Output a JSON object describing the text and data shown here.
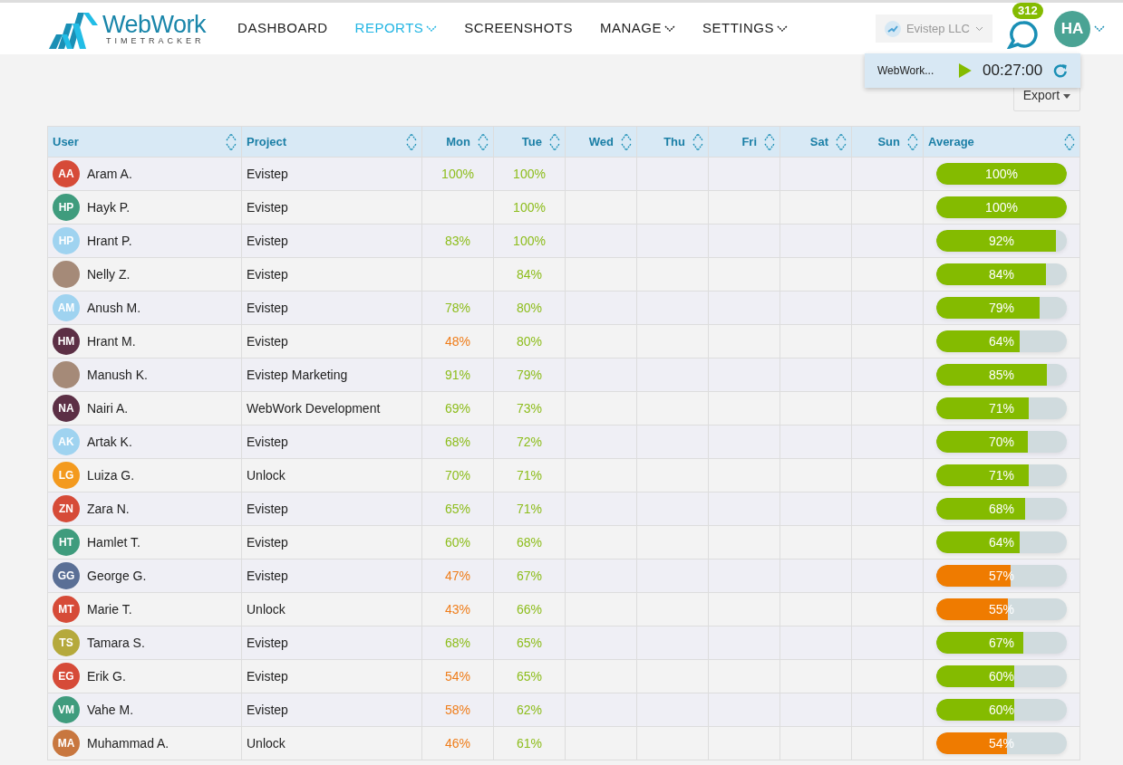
{
  "brand": {
    "name": "WebWork",
    "tagline": "TIMETRACKER"
  },
  "nav": [
    {
      "label": "DASHBOARD",
      "selected": false,
      "dropdown": false
    },
    {
      "label": "REPORTS",
      "selected": true,
      "dropdown": true
    },
    {
      "label": "SCREENSHOTS",
      "selected": false,
      "dropdown": false
    },
    {
      "label": "MANAGE",
      "selected": false,
      "dropdown": true
    },
    {
      "label": "SETTINGS",
      "selected": false,
      "dropdown": true
    }
  ],
  "company": {
    "name": "Evistep LLC"
  },
  "notifications": {
    "count": "312"
  },
  "user": {
    "initials": "HA"
  },
  "timer": {
    "project": "WebWork...",
    "time": "00:27:00"
  },
  "export": {
    "label": "Export"
  },
  "table": {
    "columns": [
      "User",
      "Project",
      "Mon",
      "Tue",
      "Wed",
      "Thu",
      "Fri",
      "Sat",
      "Sun",
      "Average"
    ],
    "rows": [
      {
        "user": "Aram  A.",
        "avatar": {
          "kind": "initials",
          "initials": "AA",
          "color": "#d64b38"
        },
        "project": "Evistep",
        "days": {
          "mon": {
            "text": "100%",
            "color": "#8dbd1c"
          },
          "tue": {
            "text": "100%",
            "color": "#8dbd1c"
          }
        },
        "average": {
          "text": "100%",
          "level": 1,
          "color": "#84bb00"
        }
      },
      {
        "user": "Hayk  P.",
        "avatar": {
          "kind": "initials",
          "initials": "HP",
          "color": "#3f9c7d"
        },
        "project": "Evistep",
        "days": {
          "tue": {
            "text": "100%",
            "color": "#8dbd1c"
          }
        },
        "average": {
          "text": "100%",
          "level": 1,
          "color": "#84bb00"
        }
      },
      {
        "user": "Hrant  P.",
        "avatar": {
          "kind": "initials",
          "initials": "HP",
          "color": "#9fd3f0"
        },
        "project": "Evistep",
        "days": {
          "mon": {
            "text": "83%",
            "color": "#8dbd1c"
          },
          "tue": {
            "text": "100%",
            "color": "#8dbd1c"
          }
        },
        "average": {
          "text": "92%",
          "level": 0.92,
          "color": "#84bb00"
        }
      },
      {
        "user": "Nelly  Z.",
        "avatar": {
          "kind": "photo"
        },
        "project": "Evistep",
        "days": {
          "tue": {
            "text": "84%",
            "color": "#8dbd1c"
          }
        },
        "average": {
          "text": "84%",
          "level": 0.84,
          "color": "#84bb00"
        }
      },
      {
        "user": "Anush  M.",
        "avatar": {
          "kind": "initials",
          "initials": "AM",
          "color": "#9fd3f0"
        },
        "project": "Evistep",
        "days": {
          "mon": {
            "text": "78%",
            "color": "#8dbd1c"
          },
          "tue": {
            "text": "80%",
            "color": "#8dbd1c"
          }
        },
        "average": {
          "text": "79%",
          "level": 0.79,
          "color": "#84bb00"
        }
      },
      {
        "user": "Hrant  M.",
        "avatar": {
          "kind": "initials",
          "initials": "HM",
          "color": "#5c2f45"
        },
        "project": "Evistep",
        "days": {
          "mon": {
            "text": "48%",
            "color": "#ef7d1a"
          },
          "tue": {
            "text": "80%",
            "color": "#8dbd1c"
          }
        },
        "average": {
          "text": "64%",
          "level": 0.64,
          "color": "#84bb00"
        }
      },
      {
        "user": "Manush  K.",
        "avatar": {
          "kind": "photo"
        },
        "project": "Evistep  Marketing",
        "days": {
          "mon": {
            "text": "91%",
            "color": "#8dbd1c"
          },
          "tue": {
            "text": "79%",
            "color": "#8dbd1c"
          }
        },
        "average": {
          "text": "85%",
          "level": 0.85,
          "color": "#84bb00"
        }
      },
      {
        "user": "Nairi  A.",
        "avatar": {
          "kind": "initials",
          "initials": "NA",
          "color": "#5c2f45"
        },
        "project": "WebWork  Development",
        "days": {
          "mon": {
            "text": "69%",
            "color": "#8dbd1c"
          },
          "tue": {
            "text": "73%",
            "color": "#8dbd1c"
          }
        },
        "average": {
          "text": "71%",
          "level": 0.71,
          "color": "#84bb00"
        }
      },
      {
        "user": "Artak  K.",
        "avatar": {
          "kind": "initials",
          "initials": "AK",
          "color": "#9fd3f0"
        },
        "project": "Evistep",
        "days": {
          "mon": {
            "text": "68%",
            "color": "#8dbd1c"
          },
          "tue": {
            "text": "72%",
            "color": "#8dbd1c"
          }
        },
        "average": {
          "text": "70%",
          "level": 0.7,
          "color": "#84bb00"
        }
      },
      {
        "user": "Luiza  G.",
        "avatar": {
          "kind": "initials",
          "initials": "LG",
          "color": "#f39a1e"
        },
        "project": "Unlock",
        "days": {
          "mon": {
            "text": "70%",
            "color": "#8dbd1c"
          },
          "tue": {
            "text": "71%",
            "color": "#8dbd1c"
          }
        },
        "average": {
          "text": "71%",
          "level": 0.71,
          "color": "#84bb00"
        }
      },
      {
        "user": "Zara  N.",
        "avatar": {
          "kind": "initials",
          "initials": "ZN",
          "color": "#d64b38"
        },
        "project": "Evistep",
        "days": {
          "mon": {
            "text": "65%",
            "color": "#8dbd1c"
          },
          "tue": {
            "text": "71%",
            "color": "#8dbd1c"
          }
        },
        "average": {
          "text": "68%",
          "level": 0.68,
          "color": "#84bb00"
        }
      },
      {
        "user": "Hamlet  T.",
        "avatar": {
          "kind": "initials",
          "initials": "HT",
          "color": "#3f9c7d"
        },
        "project": "Evistep",
        "days": {
          "mon": {
            "text": "60%",
            "color": "#8dbd1c"
          },
          "tue": {
            "text": "68%",
            "color": "#8dbd1c"
          }
        },
        "average": {
          "text": "64%",
          "level": 0.64,
          "color": "#84bb00"
        }
      },
      {
        "user": "George  G.",
        "avatar": {
          "kind": "initials",
          "initials": "GG",
          "color": "#5a6f96"
        },
        "project": "Evistep",
        "days": {
          "mon": {
            "text": "47%",
            "color": "#ef7d1a"
          },
          "tue": {
            "text": "67%",
            "color": "#8dbd1c"
          }
        },
        "average": {
          "text": "57%",
          "level": 0.57,
          "color": "#ef7b00"
        }
      },
      {
        "user": "Marie  T.",
        "avatar": {
          "kind": "initials",
          "initials": "MT",
          "color": "#d64b38"
        },
        "project": "Unlock",
        "days": {
          "mon": {
            "text": "43%",
            "color": "#ef7d1a"
          },
          "tue": {
            "text": "66%",
            "color": "#8dbd1c"
          }
        },
        "average": {
          "text": "55%",
          "level": 0.55,
          "color": "#ef7b00"
        }
      },
      {
        "user": "Tamara  S.",
        "avatar": {
          "kind": "initials",
          "initials": "TS",
          "color": "#b5a93c"
        },
        "project": "Evistep",
        "days": {
          "mon": {
            "text": "68%",
            "color": "#8dbd1c"
          },
          "tue": {
            "text": "65%",
            "color": "#8dbd1c"
          }
        },
        "average": {
          "text": "67%",
          "level": 0.67,
          "color": "#84bb00"
        }
      },
      {
        "user": "Erik  G.",
        "avatar": {
          "kind": "initials",
          "initials": "EG",
          "color": "#d64b38"
        },
        "project": "Evistep",
        "days": {
          "mon": {
            "text": "54%",
            "color": "#ef7d1a"
          },
          "tue": {
            "text": "65%",
            "color": "#8dbd1c"
          }
        },
        "average": {
          "text": "60%",
          "level": 0.6,
          "color": "#84bb00"
        }
      },
      {
        "user": "Vahe  M.",
        "avatar": {
          "kind": "initials",
          "initials": "VM",
          "color": "#3f9c7d"
        },
        "project": "Evistep",
        "days": {
          "mon": {
            "text": "58%",
            "color": "#ef7d1a"
          },
          "tue": {
            "text": "62%",
            "color": "#8dbd1c"
          }
        },
        "average": {
          "text": "60%",
          "level": 0.6,
          "color": "#84bb00"
        }
      },
      {
        "user": "Muhammad  A.",
        "avatar": {
          "kind": "initials",
          "initials": "MA",
          "color": "#c8773f"
        },
        "project": "Unlock",
        "days": {
          "mon": {
            "text": "46%",
            "color": "#ef7d1a"
          },
          "tue": {
            "text": "61%",
            "color": "#8dbd1c"
          }
        },
        "average": {
          "text": "54%",
          "level": 0.54,
          "color": "#ef7b00"
        }
      }
    ]
  }
}
